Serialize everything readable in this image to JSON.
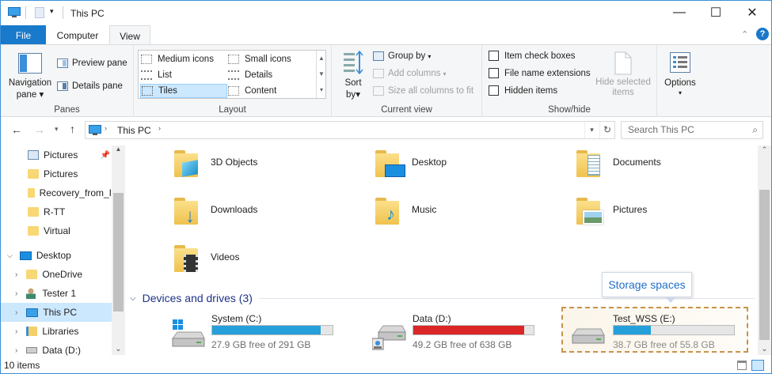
{
  "window": {
    "title": "This PC"
  },
  "tabs": {
    "file": "File",
    "computer": "Computer",
    "view": "View"
  },
  "ribbon": {
    "panes": {
      "label": "Panes",
      "navigation_pane": "Navigation",
      "navigation_pane2": "pane",
      "preview_pane": "Preview pane",
      "details_pane": "Details pane"
    },
    "layout": {
      "label": "Layout",
      "options": [
        "Medium icons",
        "Small icons",
        "List",
        "Details",
        "Tiles",
        "Content"
      ],
      "selected": "Tiles"
    },
    "current_view": {
      "label": "Current view",
      "sort_by": "Sort",
      "sort_by2": "by",
      "group_by": "Group by",
      "add_columns": "Add columns",
      "size_columns": "Size all columns to fit"
    },
    "show_hide": {
      "label": "Show/hide",
      "item_check_boxes": "Item check boxes",
      "file_name_extensions": "File name extensions",
      "hidden_items": "Hidden items",
      "hide_selected": "Hide selected",
      "hide_selected2": "items"
    },
    "options": {
      "label": "Options"
    }
  },
  "address": {
    "path": "This PC",
    "search_placeholder": "Search This PC"
  },
  "nav": {
    "items": [
      {
        "label": "Pictures"
      },
      {
        "label": "Pictures"
      },
      {
        "label": "Recovery_from_I"
      },
      {
        "label": "R-TT"
      },
      {
        "label": "Virtual"
      },
      {
        "label": "Desktop"
      },
      {
        "label": "OneDrive"
      },
      {
        "label": "Tester 1"
      },
      {
        "label": "This PC"
      },
      {
        "label": "Libraries"
      },
      {
        "label": "Data (D:)"
      }
    ]
  },
  "folders": [
    "3D Objects",
    "Desktop",
    "Documents",
    "Downloads",
    "Music",
    "Pictures",
    "Videos"
  ],
  "devices": {
    "heading": "Devices and drives (3)",
    "drives": [
      {
        "name": "System (C:)",
        "free": "27.9 GB free of 291 GB",
        "used_fraction": 0.904,
        "color": "#26a0da"
      },
      {
        "name": "Data (D:)",
        "free": "49.2 GB free of 638 GB",
        "used_fraction": 0.923,
        "color": "#da2626"
      },
      {
        "name": "Test_WSS (E:)",
        "free": "38.7 GB free of 55.8 GB",
        "used_fraction": 0.306,
        "color": "#26a0da"
      }
    ]
  },
  "callout": "Storage spaces",
  "status": {
    "items": "10 items"
  }
}
